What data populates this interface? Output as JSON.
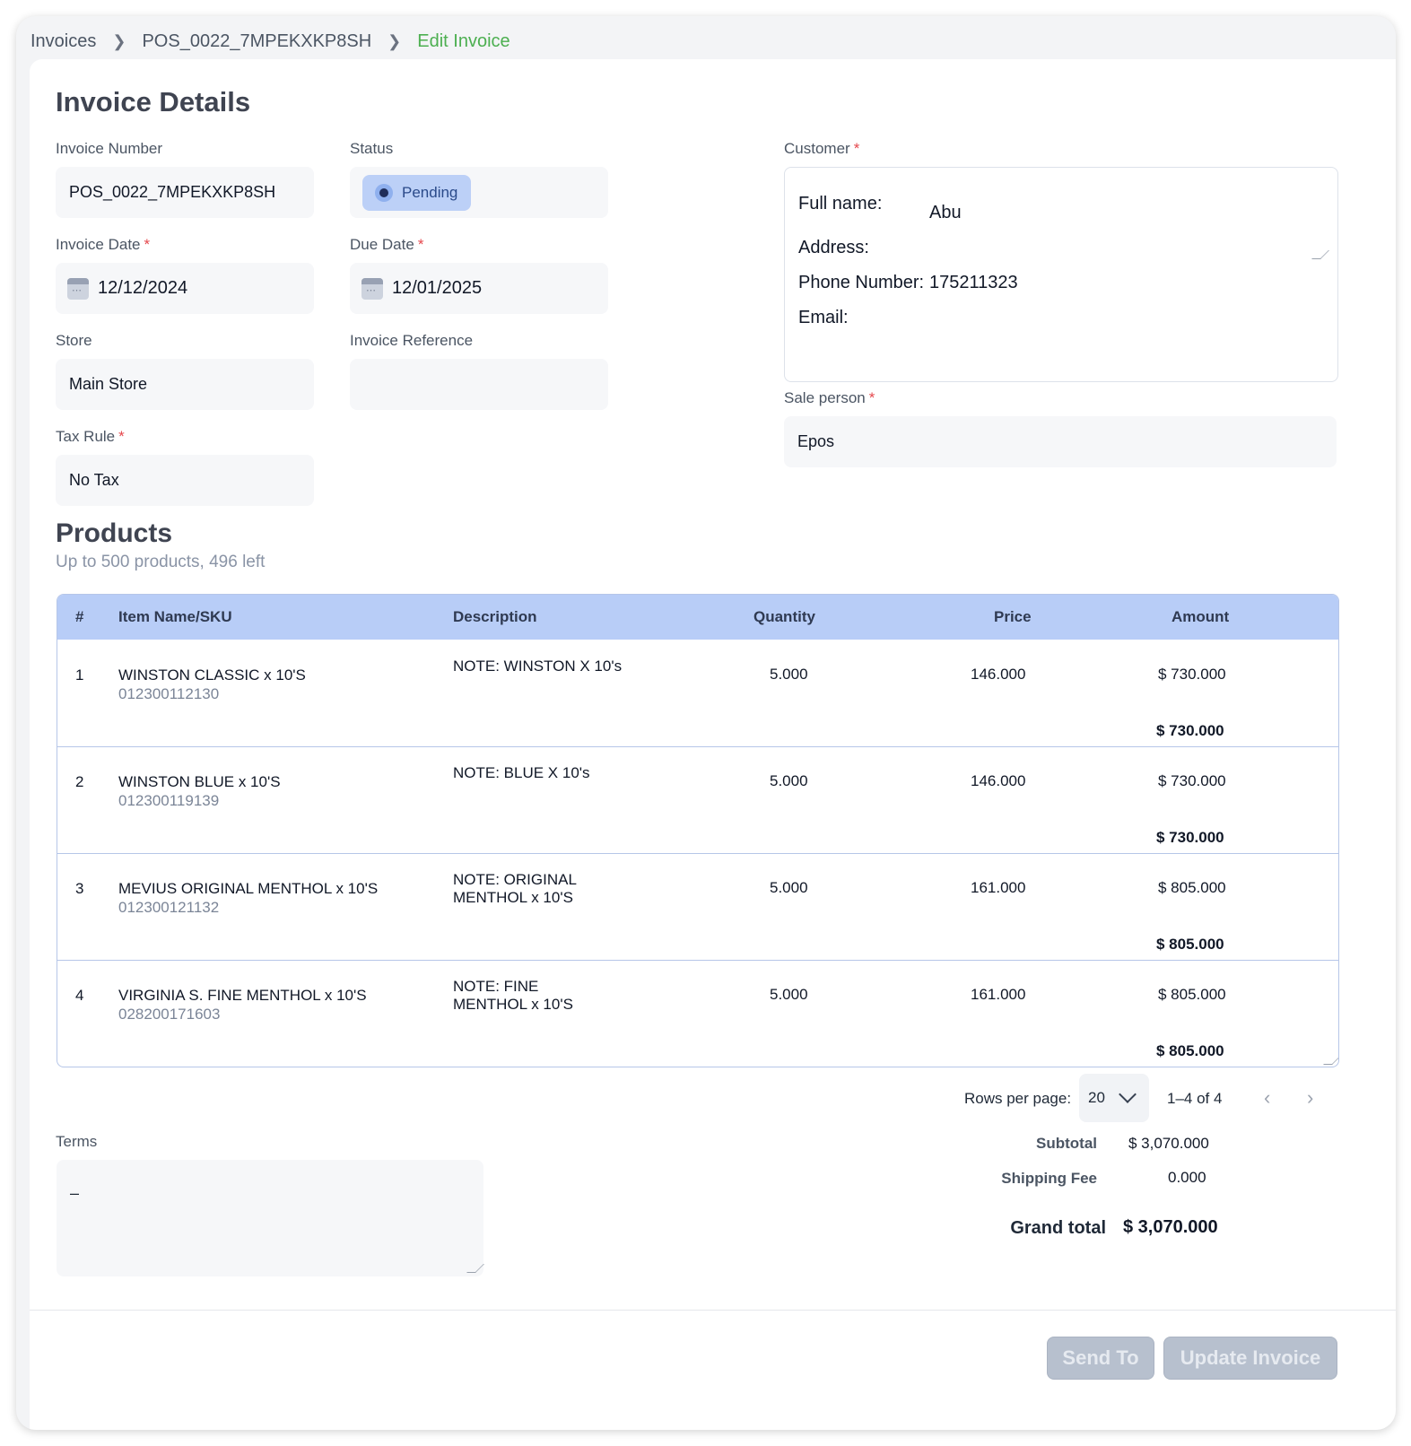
{
  "breadcrumb": {
    "items": [
      "Invoices",
      "POS_0022_7MPEKXKP8SH"
    ],
    "current": "Edit Invoice"
  },
  "invoice_details": {
    "title": "Invoice Details",
    "invoice_number": {
      "label": "Invoice Number",
      "value": "POS_0022_7MPEKXKP8SH"
    },
    "status": {
      "label": "Status",
      "value": "Pending"
    },
    "invoice_date": {
      "label": "Invoice Date",
      "value": "12/12/2024"
    },
    "due_date": {
      "label": "Due Date",
      "value": "12/01/2025"
    },
    "store": {
      "label": "Store",
      "value": "Main Store"
    },
    "invoice_reference": {
      "label": "Invoice Reference",
      "value": ""
    },
    "tax_rule": {
      "label": "Tax Rule",
      "value": "No Tax"
    },
    "customer": {
      "label": "Customer",
      "full_name_label": "Full name:",
      "full_name": "Abu",
      "address_label": "Address:",
      "phone_label": "Phone Number:",
      "phone": "175211323",
      "email_label": "Email:"
    },
    "sale_person": {
      "label": "Sale person",
      "value": "Epos"
    },
    "required_mark": "*"
  },
  "products": {
    "title": "Products",
    "subtitle": "Up to 500 products, 496 left",
    "columns": [
      "#",
      "Item Name/SKU",
      "Description",
      "Quantity",
      "Price",
      "Amount"
    ],
    "rows": [
      {
        "num": "1",
        "name": "WINSTON CLASSIC x 10'S",
        "sku": "012300112130",
        "desc1": "NOTE: WINSTON X 10's",
        "desc2": "",
        "qty": "5.000",
        "price": "146.000",
        "amount": "$ 730.000",
        "total": "$ 730.000"
      },
      {
        "num": "2",
        "name": "WINSTON BLUE x 10'S",
        "sku": "012300119139",
        "desc1": "NOTE: BLUE X 10's",
        "desc2": "",
        "qty": "5.000",
        "price": "146.000",
        "amount": "$ 730.000",
        "total": "$ 730.000"
      },
      {
        "num": "3",
        "name": "MEVIUS ORIGINAL MENTHOL x 10'S",
        "sku": "012300121132",
        "desc1": "NOTE: ORIGINAL",
        "desc2": "MENTHOL x 10'S",
        "qty": "5.000",
        "price": "161.000",
        "amount": "$ 805.000",
        "total": "$ 805.000"
      },
      {
        "num": "4",
        "name": "VIRGINIA S. FINE MENTHOL x 10'S",
        "sku": "028200171603",
        "desc1": "NOTE: FINE",
        "desc2": "MENTHOL x 10'S",
        "qty": "5.000",
        "price": "161.000",
        "amount": "$ 805.000",
        "total": "$ 805.000"
      }
    ],
    "pagination": {
      "rows_per_page_label": "Rows per page:",
      "rows_per_page": "20",
      "range": "1–4 of 4",
      "prev_icon": "chevron-left-icon",
      "next_icon": "chevron-right-icon"
    }
  },
  "terms": {
    "label": "Terms",
    "value": "–"
  },
  "summary": {
    "subtotal_label": "Subtotal",
    "subtotal": "$ 3,070.000",
    "shipping_label": "Shipping Fee",
    "shipping": "0.000",
    "grand_total_label": "Grand total",
    "grand_total": "$ 3,070.000"
  },
  "actions": {
    "send_to": "Send To",
    "update_invoice": "Update Invoice"
  },
  "colors": {
    "accent_green": "#4caf50",
    "table_header": "#b8cdf7",
    "status_chip": "#bcd0f7",
    "required": "#e5484d",
    "disabled_button": "#b7c0ce"
  }
}
